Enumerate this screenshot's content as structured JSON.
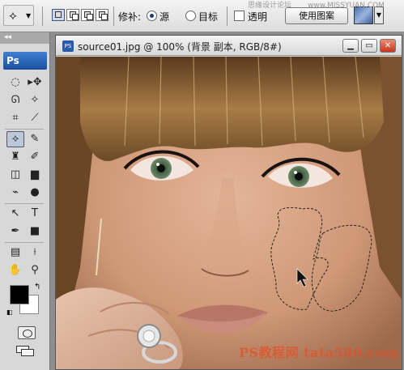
{
  "options_bar": {
    "patch_label": "修补:",
    "source_label": "源",
    "destination_label": "目标",
    "transparent_label": "透明",
    "use_pattern_label": "使用图案",
    "watermark_text": "思缘设计论坛",
    "watermark_url": "www.MISSYUAN.COM",
    "source_selected": true,
    "destination_selected": false,
    "transparent_checked": false
  },
  "toolbox": {
    "app_badge": "Ps",
    "active_tool": "patch-tool"
  },
  "document": {
    "title": "source01.jpg @ 100% (背景 副本, RGB/8#)",
    "file_icon_label": "PS",
    "image_watermark": "PS教程网 tata580.com"
  },
  "colors": {
    "foreground": "#000000",
    "background": "#ffffff",
    "active_tool_highlight": "#bcc8da"
  }
}
